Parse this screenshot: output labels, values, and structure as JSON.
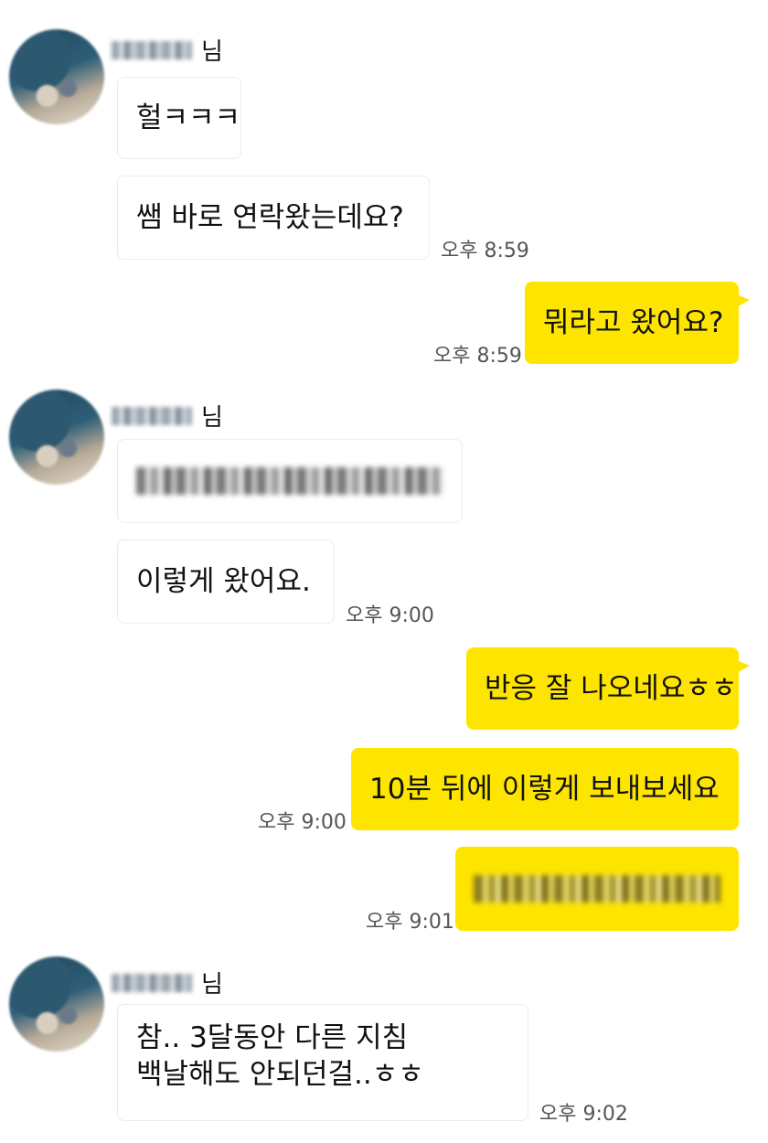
{
  "sender_suffix": "님",
  "blurred_name_label": "",
  "messages": {
    "m1": "헐ㅋㅋㅋ",
    "m2": "쌤 바로 연락왔는데요?",
    "m3": "뭐라고 왔어요?",
    "m5": "이렇게 왔어요.",
    "m6": "반응 잘 나오네요ㅎㅎ",
    "m7": "10분 뒤에 이렇게 보내보세요",
    "m9_line1": "참.. 3달동안 다른 지침",
    "m9_line2": "백날해도 안되던걸..ㅎㅎ"
  },
  "times": {
    "t1": "오후 8:59",
    "t2": "오후 8:59",
    "t3": "오후 9:00",
    "t4": "오후 9:00",
    "t5": "오후 9:01",
    "t6": "오후 9:02"
  },
  "colors": {
    "my_bubble": "#fee500",
    "their_bubble": "#ffffff",
    "background": "#ffffff"
  }
}
